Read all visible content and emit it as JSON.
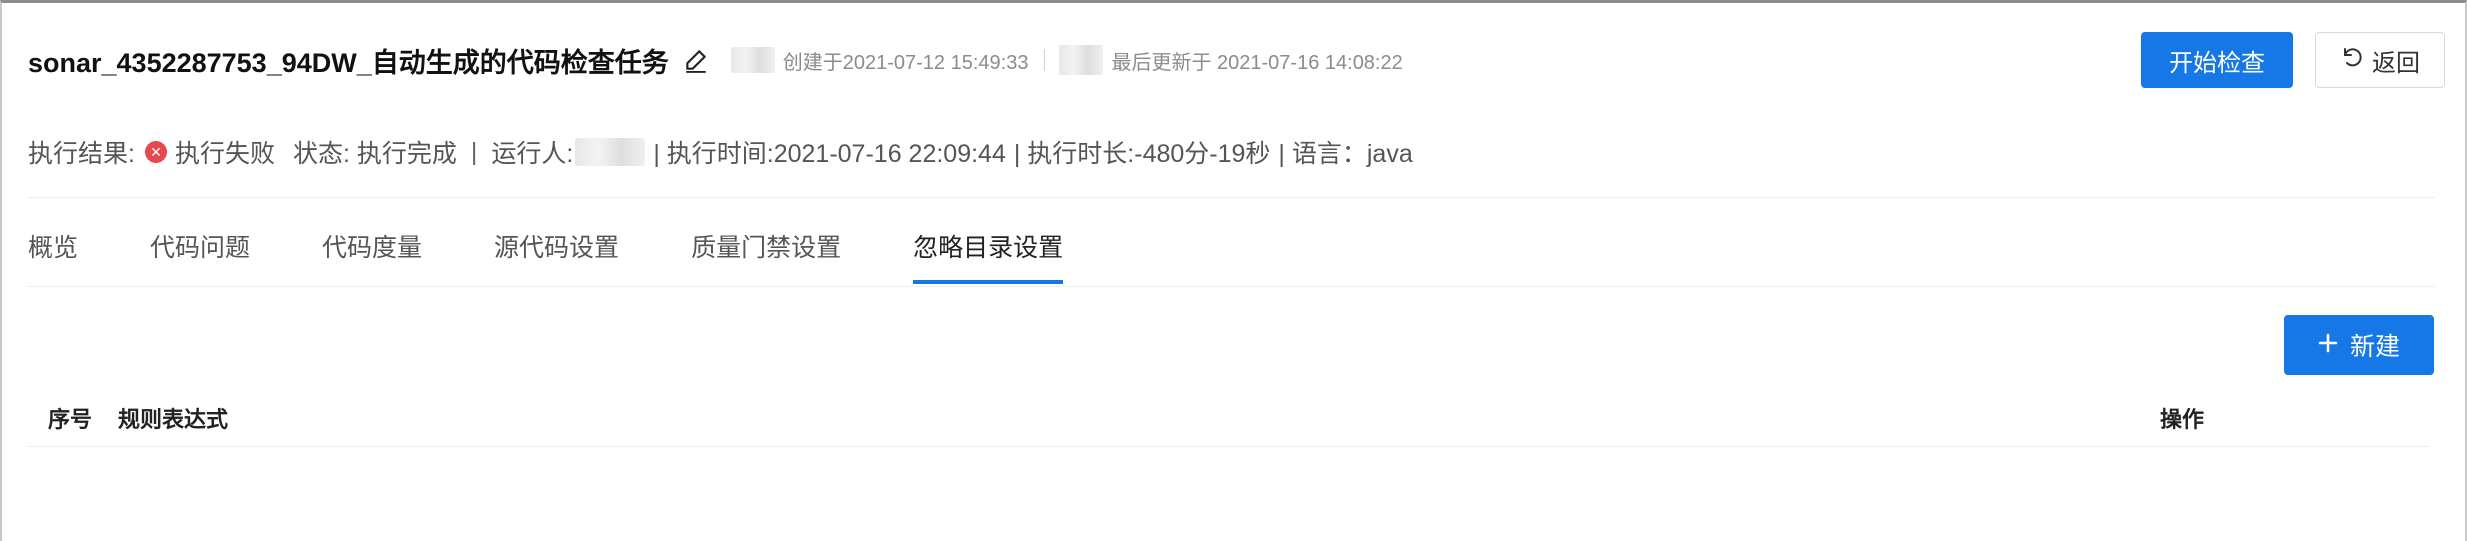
{
  "header": {
    "title": "sonar_4352287753_94DW_自动生成的代码检查任务",
    "created_label": "创建于2021-07-12 15:49:33",
    "updated_label": "最后更新于 2021-07-16 14:08:22",
    "start_button": "开始检查",
    "back_button": "返回"
  },
  "info": {
    "result_label": "执行结果:",
    "result_value": "执行失败",
    "status": "状态: 执行完成",
    "runner_label": "运行人:",
    "exec_time": "| 执行时间:2021-07-16 22:09:44",
    "duration": "| 执行时长:-480分-19秒",
    "language": "| 语言：java"
  },
  "tabs": [
    {
      "label": "概览"
    },
    {
      "label": "代码问题"
    },
    {
      "label": "代码度量"
    },
    {
      "label": "源代码设置"
    },
    {
      "label": "质量门禁设置"
    },
    {
      "label": "忽略目录设置"
    }
  ],
  "active_tab": "忽略目录设置",
  "table": {
    "new_button": "新建",
    "columns": [
      "序号",
      "规则表达式",
      "操作"
    ],
    "rows": []
  },
  "colors": {
    "primary": "#1677e6",
    "fail": "#e5484d",
    "muted": "#8c8c8c"
  }
}
